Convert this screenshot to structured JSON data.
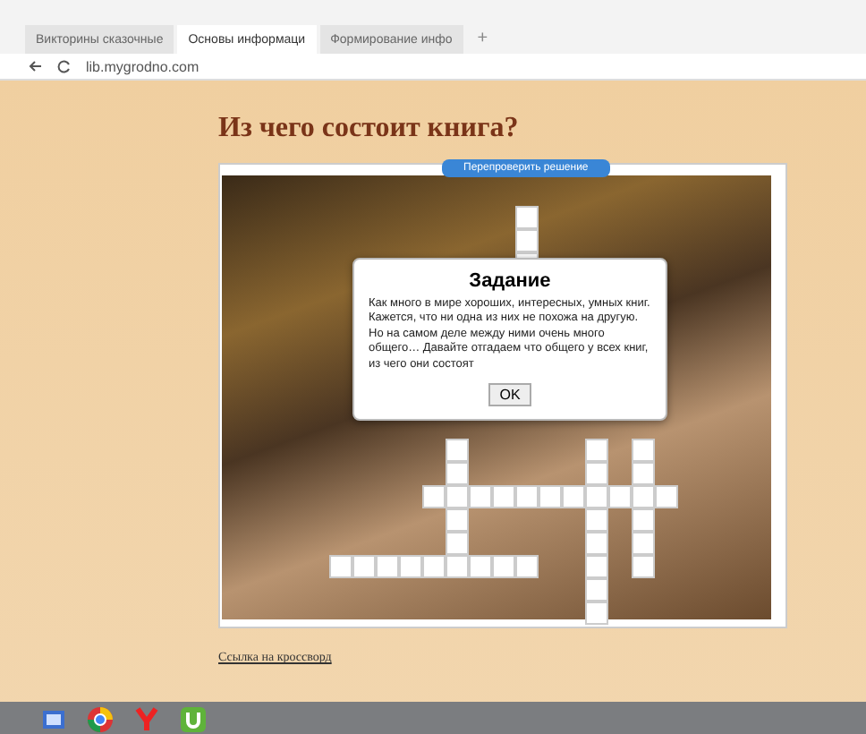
{
  "browser": {
    "tabs": [
      {
        "label": "Викторины сказочные",
        "selected": false
      },
      {
        "label": "Основы информаци",
        "selected": true
      },
      {
        "label": "Формирование инфо",
        "selected": false
      }
    ],
    "new_tab": "+",
    "url": "lib.mygrodno.com"
  },
  "page": {
    "title": "Из чего состоит книга?",
    "check_button": "Перепроверить решение",
    "dialog": {
      "title": "Задание",
      "text": "Как много в мире хороших, интересных, умных книг. Кажется, что ни одна из них не похожа на другую. Но на самом деле между ними очень много общего… Давайте отгадаем что общего у всех книг, из чего они состоят",
      "ok": "OK"
    },
    "link": "Ссылка на кроссворд"
  }
}
